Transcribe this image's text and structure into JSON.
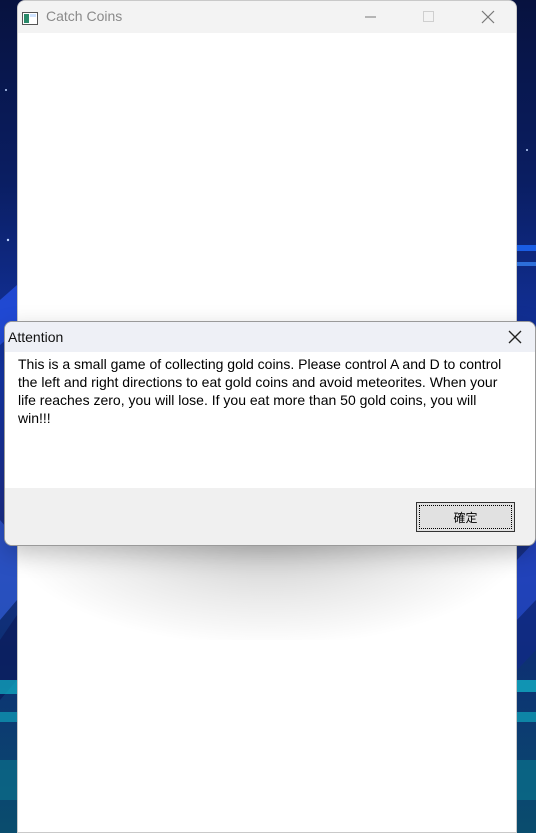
{
  "app_window": {
    "title": "Catch Coins",
    "icon": "app-window-icon",
    "controls": [
      "minimize-icon",
      "maximize-icon",
      "close-icon"
    ]
  },
  "dialog": {
    "title": "Attention",
    "message": "This is a small game of collecting gold coins. Please control A and D to control the left and right directions to eat gold coins and avoid meteorites. When your life reaches zero, you will lose. If you eat more than 50 gold coins, you will win!!!",
    "ok_label": "確定",
    "close_icon": "close-icon"
  },
  "colors": {
    "accent_desktop": "#1436a8",
    "titlebar": "#f3f3f3",
    "dialog_footer": "#f0f0f0"
  }
}
